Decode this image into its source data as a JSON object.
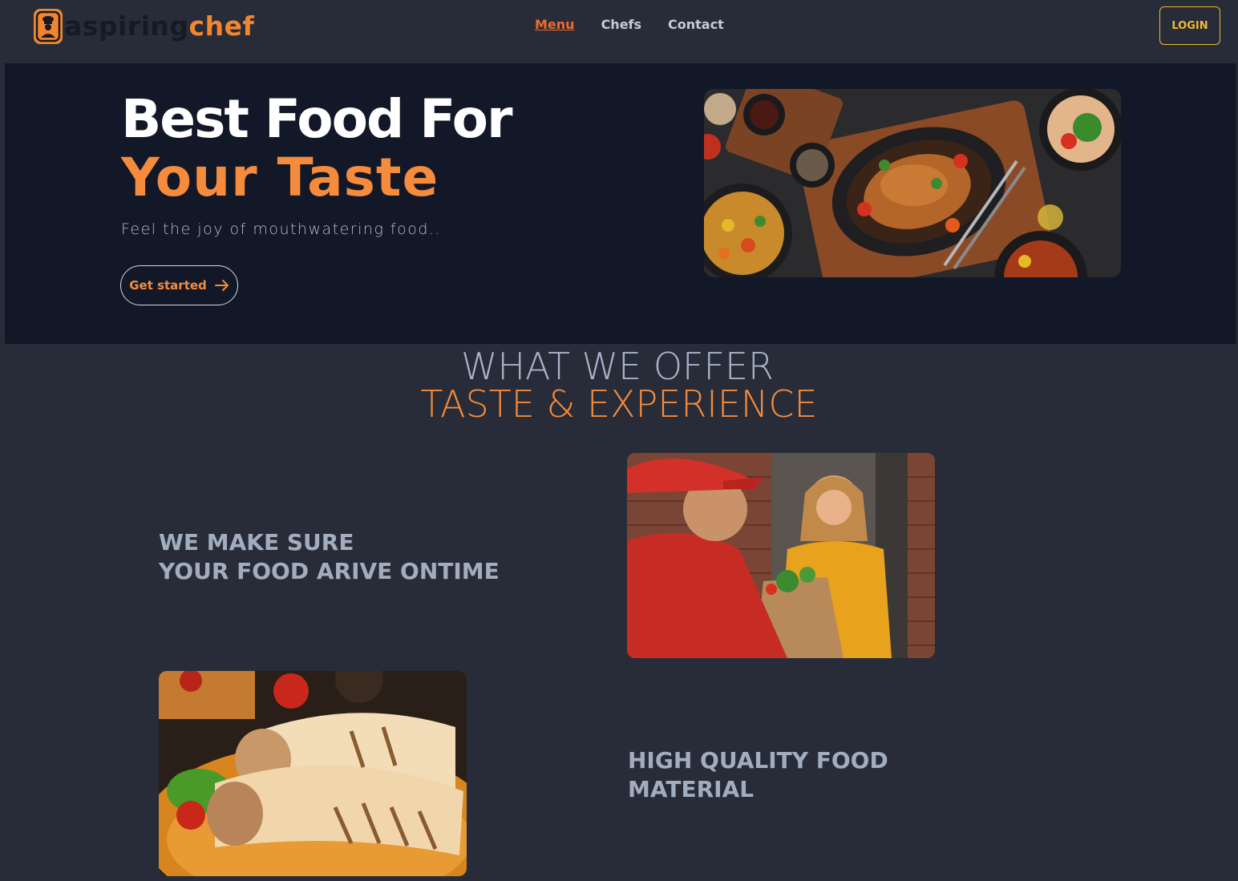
{
  "brand": {
    "name_part1": "aspiring",
    "name_part2": "chef",
    "primary": "#f2862e",
    "dark": "#151a25"
  },
  "nav": {
    "links": [
      {
        "label": "Menu",
        "active": true
      },
      {
        "label": "Chefs",
        "active": false
      },
      {
        "label": "Contact",
        "active": false
      }
    ],
    "login_label": "LOGIN"
  },
  "hero": {
    "title_line1": "Best Food For",
    "title_line2": "Your Taste",
    "subtitle": "Feel the joy of mouthwatering food..",
    "cta_label": "Get started",
    "cta_icon": "arrow-right-icon"
  },
  "offer": {
    "heading": "WHAT WE OFFER",
    "subheading": "TASTE & EXPERIENCE",
    "features": [
      {
        "line1": "WE MAKE SURE",
        "line2": "YOUR FOOD ARIVE ONTIME"
      },
      {
        "line1": "HIGH QUALITY FOOD",
        "line2": "MATERIAL"
      }
    ]
  }
}
